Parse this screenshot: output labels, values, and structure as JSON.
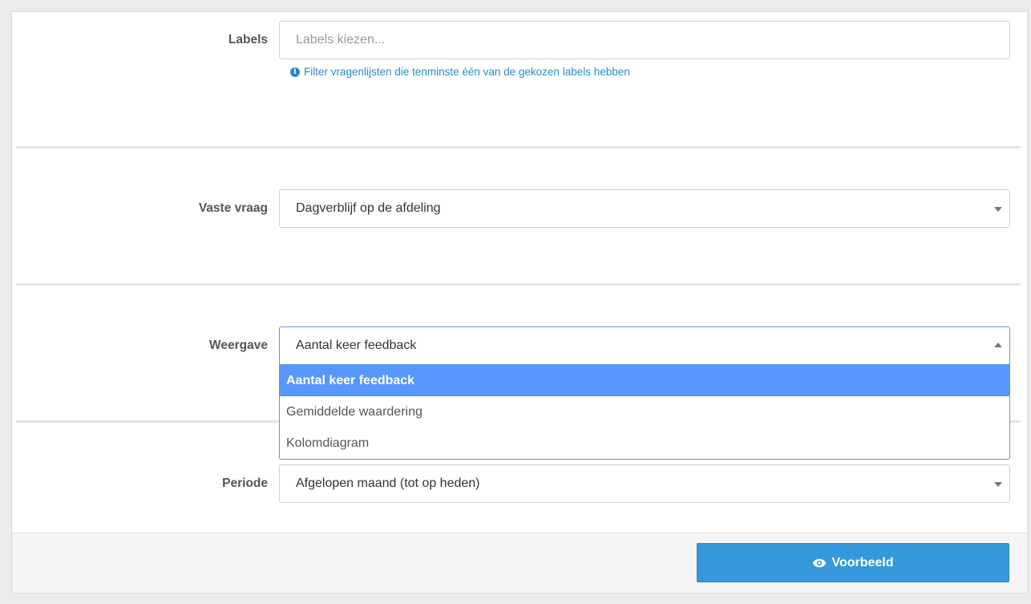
{
  "labels": {
    "label": "Labels",
    "placeholder": "Labels kiezen...",
    "help": "Filter vragenlijsten die tenminste één van de gekozen labels hebben"
  },
  "fixed_question": {
    "label": "Vaste vraag",
    "value": "Dagverblijf op de afdeling"
  },
  "display": {
    "label": "Weergave",
    "value": "Aantal keer feedback",
    "options": [
      "Aantal keer feedback",
      "Gemiddelde waardering",
      "Kolomdiagram"
    ],
    "selected_index": 0
  },
  "period": {
    "label": "Periode",
    "value": "Afgelopen maand (tot op heden)"
  },
  "footer": {
    "preview_label": "Voorbeeld"
  },
  "colors": {
    "primary": "#3498db",
    "highlight": "#5897fb",
    "help_text": "#2a8bbf"
  },
  "icons": {
    "help": "info-circle-icon",
    "preview": "eye-icon",
    "select_closed": "caret-down-icon",
    "select_open": "caret-up-icon"
  }
}
